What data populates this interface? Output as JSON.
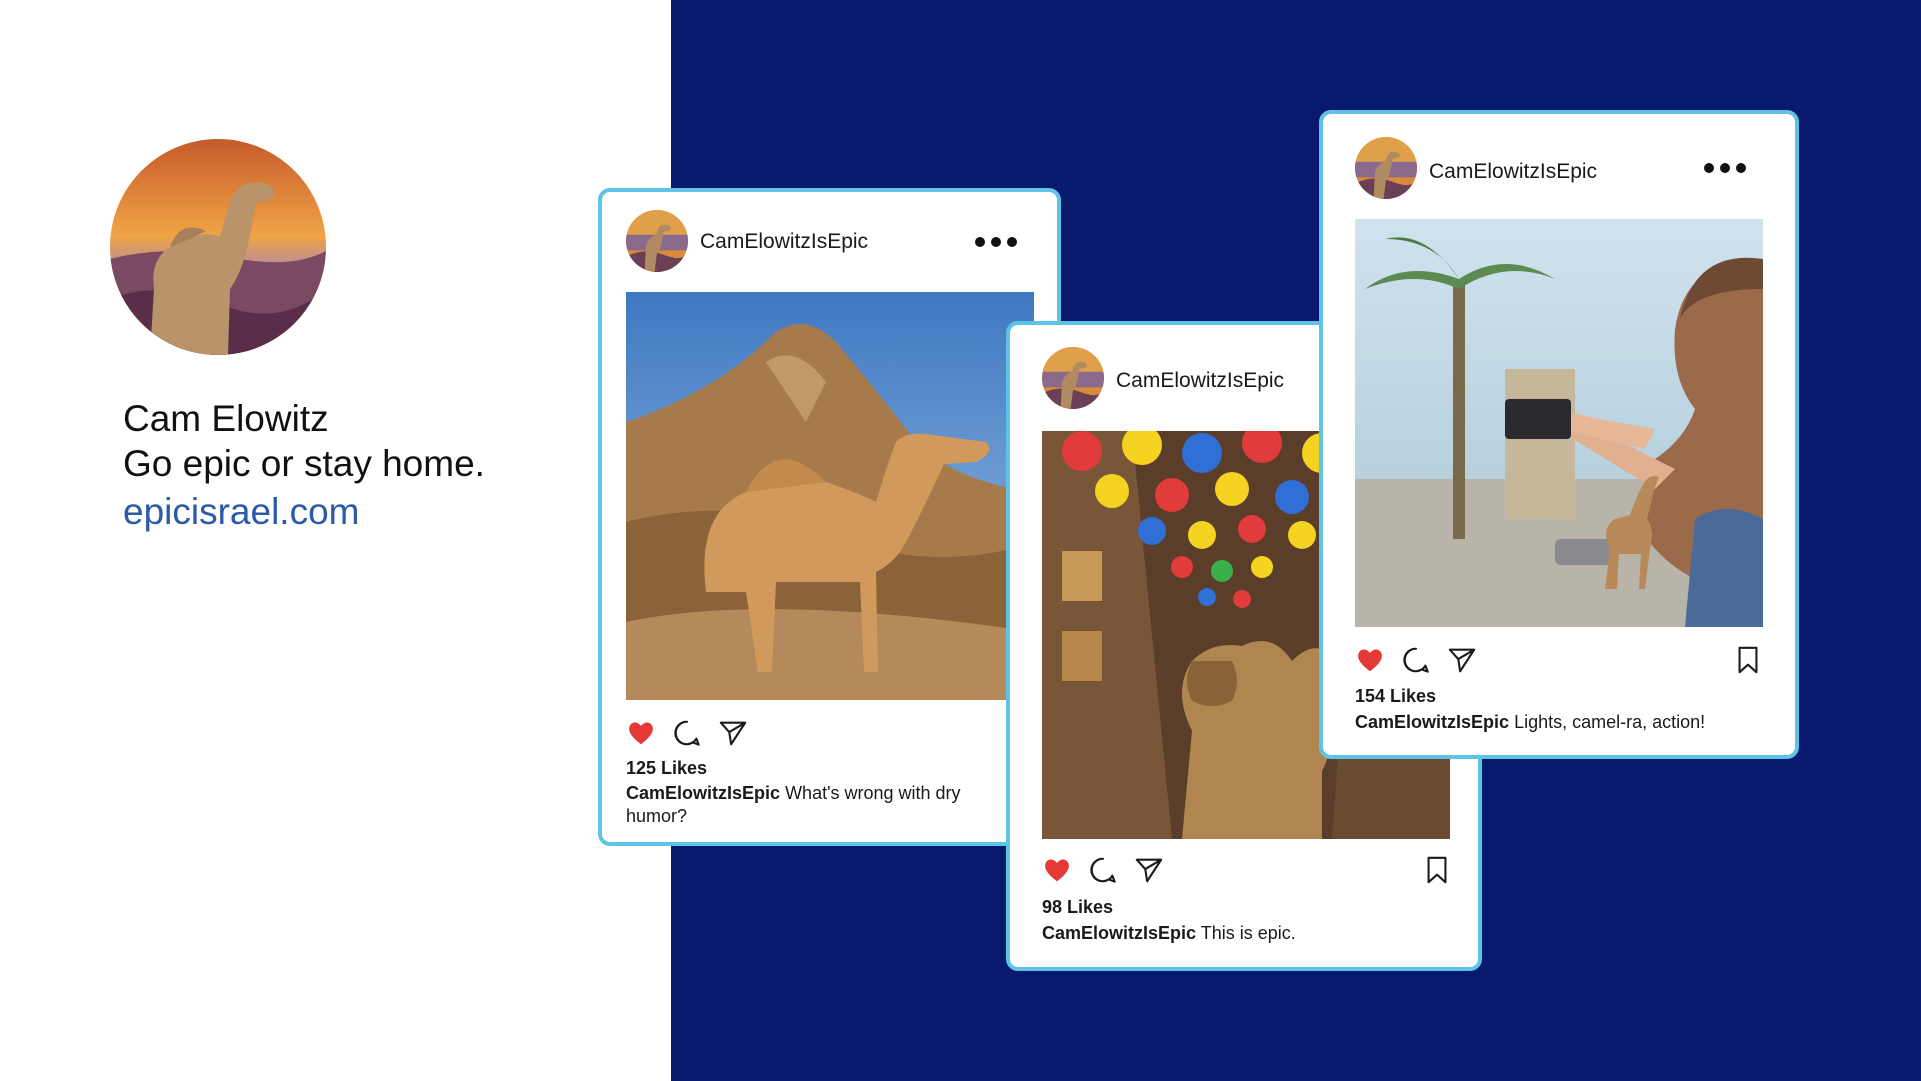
{
  "profile": {
    "name": "Cam Elowitz",
    "tagline": "Go epic or stay home.",
    "website": "epicisrael.com"
  },
  "colors": {
    "navy_background": "#071a6e",
    "card_border": "#5ec3e6",
    "link": "#2b5aa6",
    "like_heart": "#e53935"
  },
  "posts": [
    {
      "username": "CamElowitzIsEpic",
      "likes": "125 Likes",
      "caption_user": "CamElowitzIsEpic",
      "caption_text": "What's wrong with dry humor?",
      "liked": true,
      "icons": [
        "heart-icon",
        "comment-icon",
        "share-icon"
      ]
    },
    {
      "username": "CamElowitzIsEpic",
      "likes": "98 Likes",
      "caption_user": "CamElowitzIsEpic",
      "caption_text": "This is epic.",
      "liked": true,
      "icons": [
        "heart-icon",
        "comment-icon",
        "share-icon",
        "bookmark-icon"
      ]
    },
    {
      "username": "CamElowitzIsEpic",
      "likes": "154 Likes",
      "caption_user": "CamElowitzIsEpic",
      "caption_text": "Lights, camel-ra, action!",
      "liked": true,
      "icons": [
        "heart-icon",
        "comment-icon",
        "share-icon",
        "bookmark-icon"
      ]
    }
  ]
}
